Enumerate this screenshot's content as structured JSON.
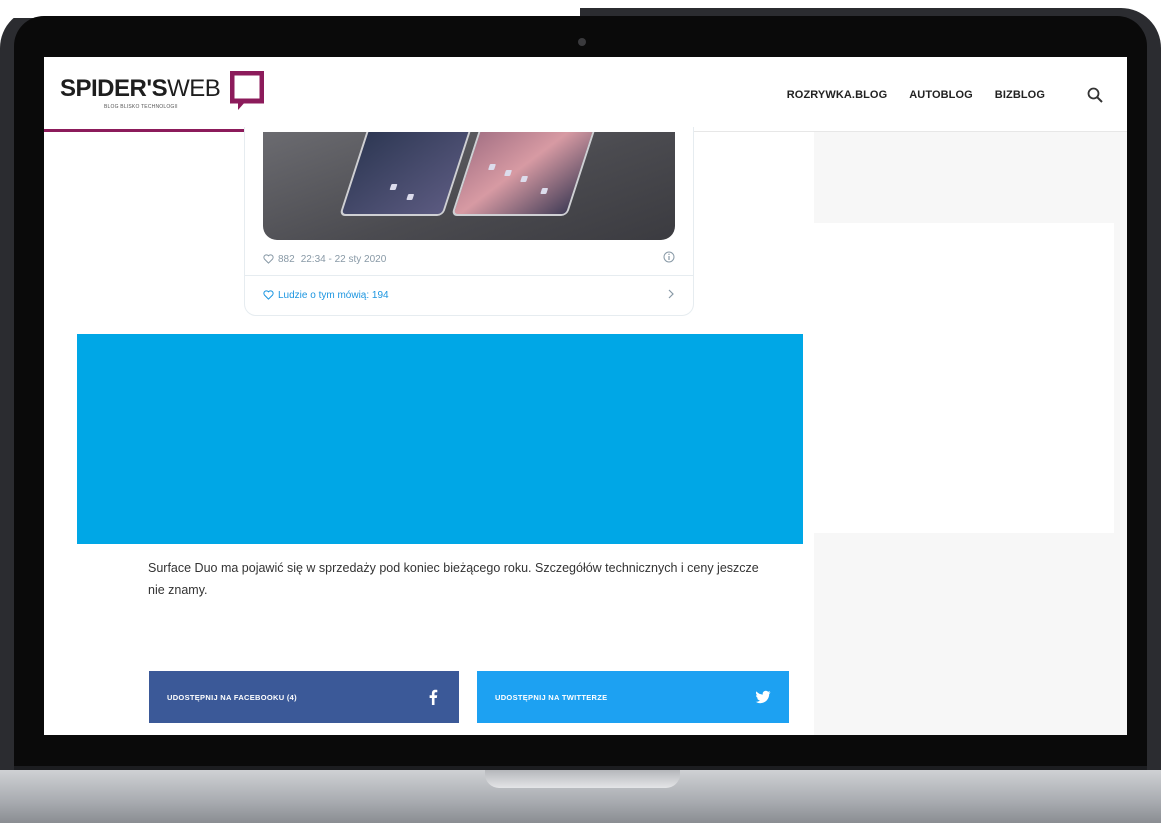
{
  "site": {
    "logo_bold": "SPIDER'S",
    "logo_light": "WEB",
    "logo_tagline": "BLOG BLISKO TECHNOLOGII",
    "brand_color": "#8c1b5b"
  },
  "nav": {
    "items": [
      "ROZRYWKA.BLOG",
      "AUTOBLOG",
      "BIZBLOG"
    ],
    "search_icon": "search-icon"
  },
  "tweet": {
    "likes": "882",
    "timestamp": "22:34 - 22 sty 2020",
    "discussion": "Ludzie o tym mówią: 194"
  },
  "article": {
    "paragraph": "Surface Duo ma pojawić się w sprzedaży pod koniec bieżącego roku. Szczegółów technicznych i ceny jeszcze nie znamy."
  },
  "share": {
    "facebook_label": "UDOSTĘPNIJ NA FACEBOOKU (4)",
    "twitter_label": "UDOSTĘPNIJ NA TWITTERZE",
    "facebook_color": "#3b5998",
    "twitter_color": "#1da1f2"
  },
  "ad": {
    "color": "#00a7e6"
  }
}
